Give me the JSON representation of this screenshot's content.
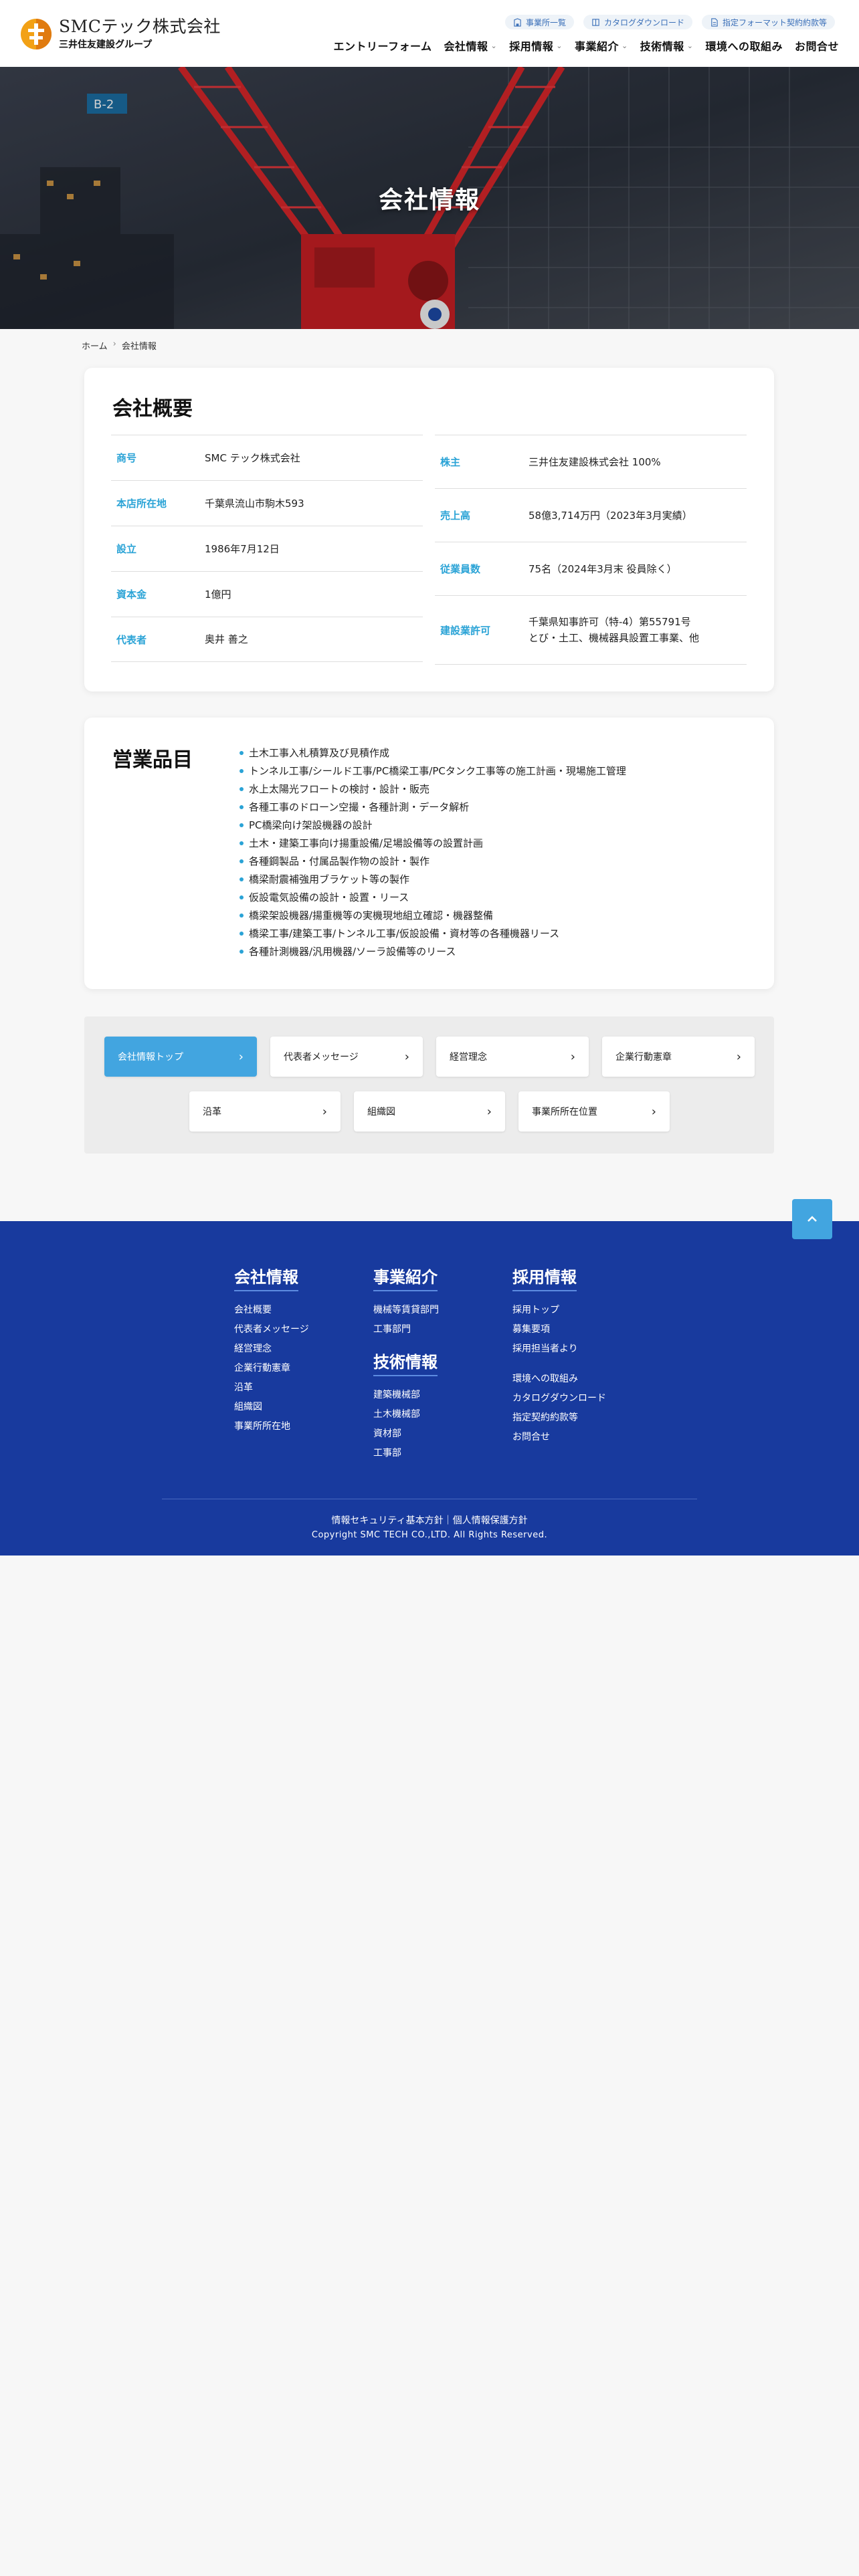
{
  "header": {
    "logo_name": "SMCテック株式会社",
    "logo_sub": "三井住友建設グループ",
    "util_links": [
      {
        "label": "事業所一覧",
        "icon": "building-icon"
      },
      {
        "label": "カタログダウンロード",
        "icon": "book-icon"
      },
      {
        "label": "指定フォーマット契約約款等",
        "icon": "document-icon"
      }
    ],
    "nav": [
      {
        "label": "エントリーフォーム",
        "dropdown": false
      },
      {
        "label": "会社情報",
        "dropdown": true
      },
      {
        "label": "採用情報",
        "dropdown": true
      },
      {
        "label": "事業紹介",
        "dropdown": true
      },
      {
        "label": "技術情報",
        "dropdown": true
      },
      {
        "label": "環境への取組み",
        "dropdown": false
      },
      {
        "label": "お問合せ",
        "dropdown": false
      }
    ]
  },
  "hero": {
    "title": "会社情報"
  },
  "breadcrumb": {
    "home": "ホーム",
    "current": "会社情報"
  },
  "overview": {
    "title": "会社概要",
    "left": [
      {
        "label": "商号",
        "value": "SMC テック株式会社"
      },
      {
        "label": "本店所在地",
        "value": "千葉県流山市駒木593"
      },
      {
        "label": "設立",
        "value": "1986年7月12日"
      },
      {
        "label": "資本金",
        "value": "1億円"
      },
      {
        "label": "代表者",
        "value": "奥井 善之"
      }
    ],
    "right": [
      {
        "label": "株主",
        "value": "三井住友建設株式会社 100%"
      },
      {
        "label": "売上高",
        "value": "58億3,714万円（2023年3月実績）"
      },
      {
        "label": "従業員数",
        "value": "75名（2024年3月末 役員除く）"
      },
      {
        "label": "建設業許可",
        "value": "千葉県知事許可（特-4）第55791号",
        "value2": "とび・土工、機械器具設置工事業、他"
      }
    ]
  },
  "items": {
    "title": "営業品目",
    "list": [
      "土木工事入札積算及び見積作成",
      "トンネル工事/シールド工事/PC橋梁工事/PCタンク工事等の施工計画・現場施工管理",
      "水上太陽光フロートの検討・設計・販売",
      "各種工事のドローン空撮・各種計測・データ解析",
      "PC橋梁向け架設機器の設計",
      "土木・建築工事向け揚重設備/足場設備等の設置計画",
      "各種鋼製品・付属品製作物の設計・製作",
      "橋梁耐震補強用ブラケット等の製作",
      "仮設電気設備の設計・設置・リース",
      "橋梁架設機器/揚重機等の実機現地組立確認・機器整備",
      "橋梁工事/建築工事/トンネル工事/仮設設備・資材等の各種機器リース",
      "各種計測機器/汎用機器/ソーラ設備等のリース"
    ]
  },
  "subnav": {
    "buttons": [
      {
        "label": "会社情報トップ",
        "active": true
      },
      {
        "label": "代表者メッセージ",
        "active": false
      },
      {
        "label": "経営理念",
        "active": false
      },
      {
        "label": "企業行動憲章",
        "active": false
      },
      {
        "label": "沿革",
        "active": false
      },
      {
        "label": "組織図",
        "active": false
      },
      {
        "label": "事業所所在位置",
        "active": false
      }
    ]
  },
  "footer": {
    "col1": {
      "heading": "会社情報",
      "links": [
        "会社概要",
        "代表者メッセージ",
        "経営理念",
        "企業行動憲章",
        "沿革",
        "組織図",
        "事業所所在地"
      ]
    },
    "col2": {
      "heading": "事業紹介",
      "links": [
        "機械等賃貸部門",
        "工事部門"
      ],
      "heading2": "技術情報",
      "links2": [
        "建築機械部",
        "土木機械部",
        "資材部",
        "工事部"
      ]
    },
    "col3": {
      "heading": "採用情報",
      "links": [
        "採用トップ",
        "募集要項",
        "採用担当者より"
      ],
      "links2": [
        "環境への取組み",
        "カタログダウンロード",
        "指定契約約款等",
        "お問合せ"
      ]
    },
    "legal": "情報セキュリティ基本方針｜個人情報保護方針",
    "copyright": "Copyright SMC TECH CO.,LTD. All Rights Reserved."
  },
  "colors": {
    "accent": "#42a5e0",
    "label_blue": "#2aa3d6",
    "footer_bg": "#183a9e"
  }
}
